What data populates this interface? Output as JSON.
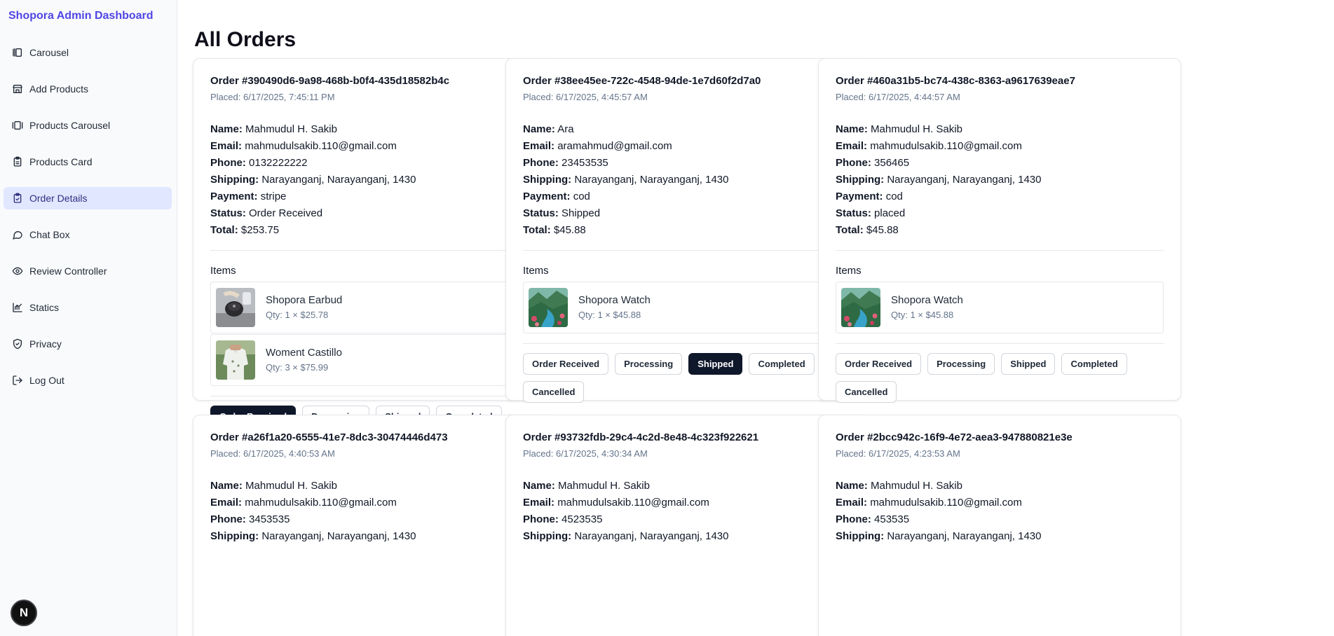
{
  "brand": "Shopora Admin Dashboard",
  "nav": [
    {
      "key": "carousel",
      "label": "Carousel",
      "icon": "carousel-icon",
      "active": false
    },
    {
      "key": "add-products",
      "label": "Add Products",
      "icon": "store-icon",
      "active": false
    },
    {
      "key": "products-carousel",
      "label": "Products Carousel",
      "icon": "gallery-icon",
      "active": false
    },
    {
      "key": "products-card",
      "label": "Products Card",
      "icon": "clipboard-list-icon",
      "active": false
    },
    {
      "key": "order-details",
      "label": "Order Details",
      "icon": "clipboard-check-icon",
      "active": true
    },
    {
      "key": "chat-box",
      "label": "Chat Box",
      "icon": "chat-bubble-icon",
      "active": false
    },
    {
      "key": "review-controller",
      "label": "Review Controller",
      "icon": "eye-icon",
      "active": false
    },
    {
      "key": "statics",
      "label": "Statics",
      "icon": "bar-chart-icon",
      "active": false
    },
    {
      "key": "privacy",
      "label": "Privacy",
      "icon": "shield-check-icon",
      "active": false
    },
    {
      "key": "log-out",
      "label": "Log Out",
      "icon": "logout-icon",
      "active": false
    }
  ],
  "badge": "N",
  "page_title": "All Orders",
  "labels": {
    "name": "Name:",
    "email": "Email:",
    "phone": "Phone:",
    "shipping": "Shipping:",
    "payment": "Payment:",
    "status": "Status:",
    "total": "Total:",
    "items": "Items"
  },
  "status_options": [
    "Order Received",
    "Processing",
    "Shipped",
    "Completed",
    "Cancelled"
  ],
  "orders": [
    {
      "id": "Order #390490d6-9a98-468b-b0f4-435d18582b4c",
      "placed": "Placed: 6/17/2025, 7:45:11 PM",
      "name": "Mahmudul H. Sakib",
      "email": "mahmudulsakib.110@gmail.com",
      "phone": "0132222222",
      "shipping": "Narayanganj, Narayanganj, 1430",
      "payment": "stripe",
      "status": "Order Received",
      "total": "$253.75",
      "active_status": "Order Received",
      "items": [
        {
          "name": "Shopora Earbud",
          "qty": "Qty: 1 × $25.78",
          "image": "earbud-photo"
        },
        {
          "name": "Woment Castillo",
          "qty": "Qty: 3 × $75.99",
          "image": "shirt-photo"
        }
      ]
    },
    {
      "id": "Order #38ee45ee-722c-4548-94de-1e7d60f2d7a0",
      "placed": "Placed: 6/17/2025, 4:45:57 AM",
      "name": "Ara",
      "email": "aramahmud@gmail.com",
      "phone": "23453535",
      "shipping": "Narayanganj, Narayanganj, 1430",
      "payment": "cod",
      "status": "Shipped",
      "total": "$45.88",
      "active_status": "Shipped",
      "items": [
        {
          "name": "Shopora Watch",
          "qty": "Qty: 1 × $45.88",
          "image": "landscape-photo"
        }
      ]
    },
    {
      "id": "Order #460a31b5-bc74-438c-8363-a9617639eae7",
      "placed": "Placed: 6/17/2025, 4:44:57 AM",
      "name": "Mahmudul H. Sakib",
      "email": "mahmudulsakib.110@gmail.com",
      "phone": "356465",
      "shipping": "Narayanganj, Narayanganj, 1430",
      "payment": "cod",
      "status": "placed",
      "total": "$45.88",
      "active_status": "",
      "items": [
        {
          "name": "Shopora Watch",
          "qty": "Qty: 1 × $45.88",
          "image": "landscape-photo"
        }
      ]
    },
    {
      "id": "Order #a26f1a20-6555-41e7-8dc3-30474446d473",
      "placed": "Placed: 6/17/2025, 4:40:53 AM",
      "name": "Mahmudul H. Sakib",
      "email": "mahmudulsakib.110@gmail.com",
      "phone": "3453535",
      "shipping": "Narayanganj, Narayanganj, 1430",
      "items": []
    },
    {
      "id": "Order #93732fdb-29c4-4c2d-8e48-4c323f922621",
      "placed": "Placed: 6/17/2025, 4:30:34 AM",
      "name": "Mahmudul H. Sakib",
      "email": "mahmudulsakib.110@gmail.com",
      "phone": "4523535",
      "shipping": "Narayanganj, Narayanganj, 1430",
      "items": []
    },
    {
      "id": "Order #2bcc942c-16f9-4e72-aea3-947880821e3e",
      "placed": "Placed: 6/17/2025, 4:23:53 AM",
      "name": "Mahmudul H. Sakib",
      "email": "mahmudulsakib.110@gmail.com",
      "phone": "453535",
      "shipping": "Narayanganj, Narayanganj, 1430",
      "items": []
    }
  ],
  "colors": {
    "brand": "#4f46e5",
    "active_nav_bg": "#e0e7ff",
    "active_button_bg": "#0f172a",
    "muted_text": "#64748b"
  }
}
